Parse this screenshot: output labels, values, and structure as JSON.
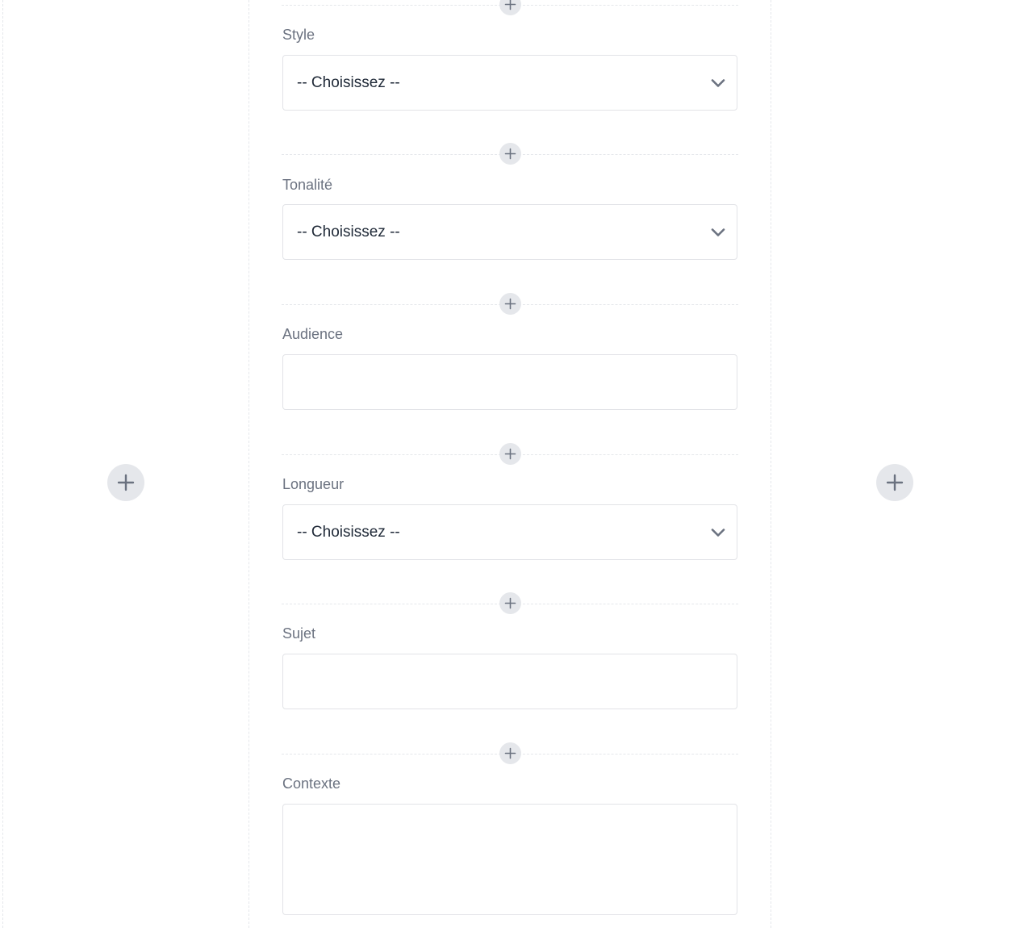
{
  "icons": {
    "add": "plus-icon",
    "dropdown": "chevron-down-icon"
  },
  "colors": {
    "add_button_bg": "#e5e7eb",
    "icon": "#6b7280",
    "label": "#6b7280",
    "field_border": "#e2e3e7",
    "select_text": "#1f2937"
  },
  "form": {
    "style": {
      "label": "Style",
      "selected": "-- Choisissez --"
    },
    "tonalite": {
      "label": "Tonalité",
      "selected": "-- Choisissez --"
    },
    "audience": {
      "label": "Audience",
      "value": ""
    },
    "longueur": {
      "label": "Longueur",
      "selected": "-- Choisissez --"
    },
    "sujet": {
      "label": "Sujet",
      "value": ""
    },
    "contexte": {
      "label": "Contexte",
      "value": ""
    }
  }
}
